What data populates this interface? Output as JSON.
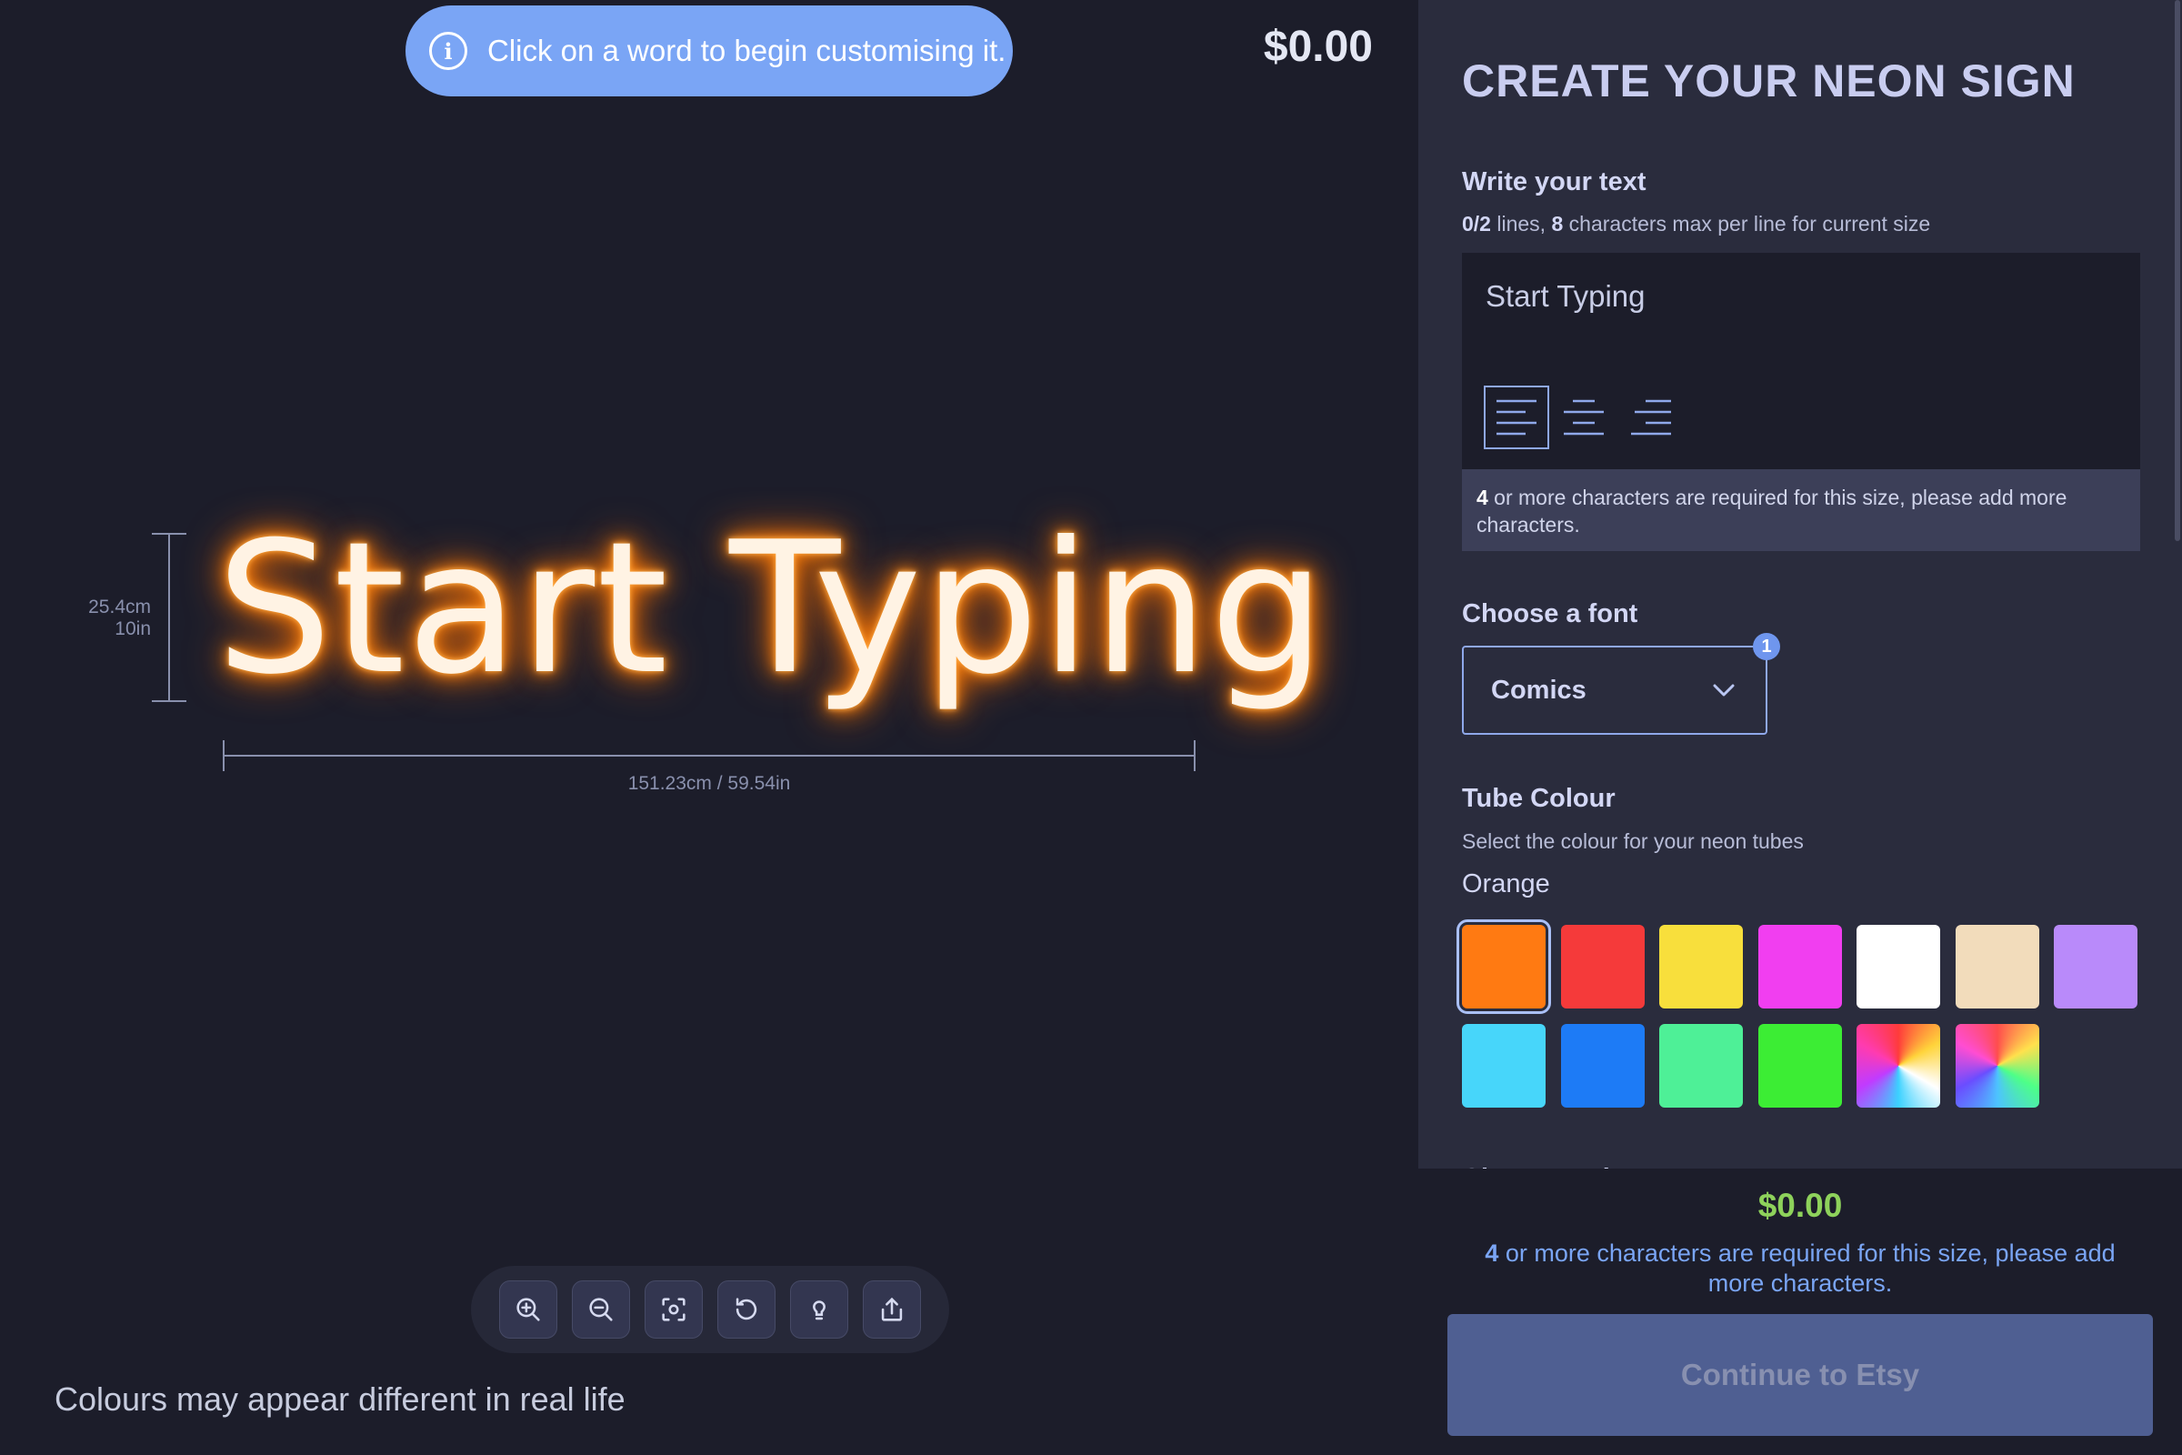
{
  "preview": {
    "hint_text": "Click on a word to begin customising it.",
    "price": "$0.00",
    "neon_text": "Start Typing",
    "neon_colour": "#ff7a00",
    "height_cm": "25.4cm",
    "height_in": "10in",
    "width_label": "151.23cm / 59.54in",
    "toolbar_icons": [
      "zoom-in-icon",
      "zoom-out-icon",
      "focus-icon",
      "rotate-icon",
      "lightbulb-icon",
      "share-icon"
    ],
    "disclaimer": "Colours may appear different in real life"
  },
  "panel": {
    "title": "CREATE YOUR NEON SIGN",
    "text_section": {
      "title": "Write your text",
      "lines_count": "0/2",
      "lines_word": " lines, ",
      "max_chars": "8",
      "max_chars_suffix": " characters max per line for current size",
      "placeholder": "Start Typing",
      "value": "",
      "alignment_options": [
        "left",
        "center",
        "right"
      ],
      "selected_alignment": "left",
      "warning_count": "4",
      "warning_text": " or more characters are required for this size, please add more characters."
    },
    "font_section": {
      "title": "Choose a font",
      "selected": "Comics",
      "badge": "1"
    },
    "colour_section": {
      "title": "Tube Colour",
      "subtitle": "Select the colour for your neon tubes",
      "selected_name": "Orange",
      "swatches": [
        "#ff7a12",
        "#f53a3a",
        "#f8df3c",
        "#f13ef0",
        "#ffffff",
        "#f2dcbb",
        "#b98afa",
        "#47d6fa",
        "#1d7bf6",
        "#4ef097",
        "#3ced34",
        "rainbow-1",
        "rainbow-2"
      ]
    },
    "next_section_cutoff": "Choose a size"
  },
  "summary": {
    "price": "$0.00",
    "warning_count": "4",
    "warning_text": " or more characters are required for this size, please add more characters.",
    "continue_label": "Continue to Etsy"
  }
}
